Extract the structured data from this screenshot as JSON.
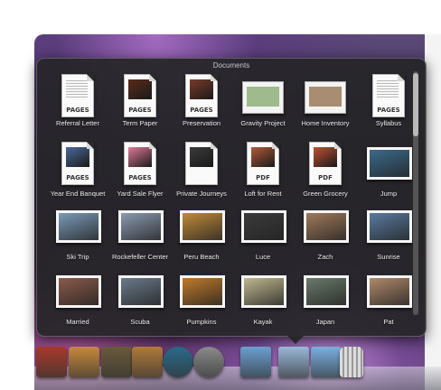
{
  "stack": {
    "title": "Documents",
    "items": [
      {
        "label": "Referral Letter",
        "kind": "doc",
        "tag": "PAGES",
        "page_color": "#ffffff"
      },
      {
        "label": "Term Paper",
        "kind": "doc-pic",
        "tag": "PAGES",
        "pic_color": "#5a2a1a"
      },
      {
        "label": "Preservation",
        "kind": "doc-pic",
        "tag": "PAGES",
        "pic_color": "#7a3a2a"
      },
      {
        "label": "Gravity Project",
        "kind": "sheet",
        "tag": "",
        "pic_color": "#8fb07a"
      },
      {
        "label": "Home Inventory",
        "kind": "sheet",
        "tag": "",
        "pic_color": "#9a7a5a"
      },
      {
        "label": "Syllabus",
        "kind": "doc",
        "tag": "PAGES",
        "page_color": "#ffffff"
      },
      {
        "label": "Year End Banquet",
        "kind": "doc-pic",
        "tag": "PAGES",
        "pic_color": "#4a6a9a"
      },
      {
        "label": "Yard Sale Flyer",
        "kind": "doc-pic",
        "tag": "PAGES",
        "pic_color": "#e07a9a"
      },
      {
        "label": "Private Journeys",
        "kind": "doc-pic",
        "tag": "",
        "pic_color": "#3a3a3a"
      },
      {
        "label": "Loft for Rent",
        "kind": "doc-pic",
        "tag": "PDF",
        "pic_color": "#b05a3a"
      },
      {
        "label": "Green Grocery",
        "kind": "doc-pic",
        "tag": "PDF",
        "pic_color": "#c05030"
      },
      {
        "label": "Jump",
        "kind": "photo",
        "tag": "",
        "pic_color": "#3a6a8a"
      },
      {
        "label": "Ski Trip",
        "kind": "photo",
        "tag": "",
        "pic_color": "#7a9ab8"
      },
      {
        "label": "Rockefeller Center",
        "kind": "photo",
        "tag": "",
        "pic_color": "#8a9ab0"
      },
      {
        "label": "Peru Beach",
        "kind": "photo",
        "tag": "",
        "pic_color": "#c08a3a"
      },
      {
        "label": "Luce",
        "kind": "photo",
        "tag": "",
        "pic_color": "#3a3a3a"
      },
      {
        "label": "Zach",
        "kind": "photo",
        "tag": "",
        "pic_color": "#a07a5a"
      },
      {
        "label": "Sunrise",
        "kind": "photo",
        "tag": "",
        "pic_color": "#5a7aa0"
      },
      {
        "label": "Married",
        "kind": "photo",
        "tag": "",
        "pic_color": "#8a5a4a"
      },
      {
        "label": "Scuba",
        "kind": "photo",
        "tag": "",
        "pic_color": "#6a7a8a"
      },
      {
        "label": "Pumpkins",
        "kind": "photo",
        "tag": "",
        "pic_color": "#c07a2a"
      },
      {
        "label": "Kayak",
        "kind": "photo",
        "tag": "",
        "pic_color": "#c0b890"
      },
      {
        "label": "Japan",
        "kind": "photo",
        "tag": "",
        "pic_color": "#6a7a6a"
      },
      {
        "label": "Pat",
        "kind": "photo",
        "tag": "",
        "pic_color": "#b08a6a"
      }
    ]
  },
  "dock": {
    "items": [
      {
        "name": "photo-booth-icon",
        "color": "#a83a2a"
      },
      {
        "name": "iphoto-icon",
        "color": "#c88a3a"
      },
      {
        "name": "imovie-icon",
        "color": "#6a5a3a"
      },
      {
        "name": "garageband-icon",
        "color": "#b07a3a"
      },
      {
        "name": "time-machine-icon",
        "color": "#2a6a8a"
      },
      {
        "name": "system-preferences-icon",
        "color": "#8a8a8a"
      },
      {
        "name": "applications-folder-icon",
        "color": "#6aa0d0"
      },
      {
        "name": "documents-stack-icon",
        "color": "#9ab8d8"
      },
      {
        "name": "downloads-folder-icon",
        "color": "#7ab0e0"
      },
      {
        "name": "trash-icon",
        "color": "#bcbcbc"
      }
    ]
  }
}
